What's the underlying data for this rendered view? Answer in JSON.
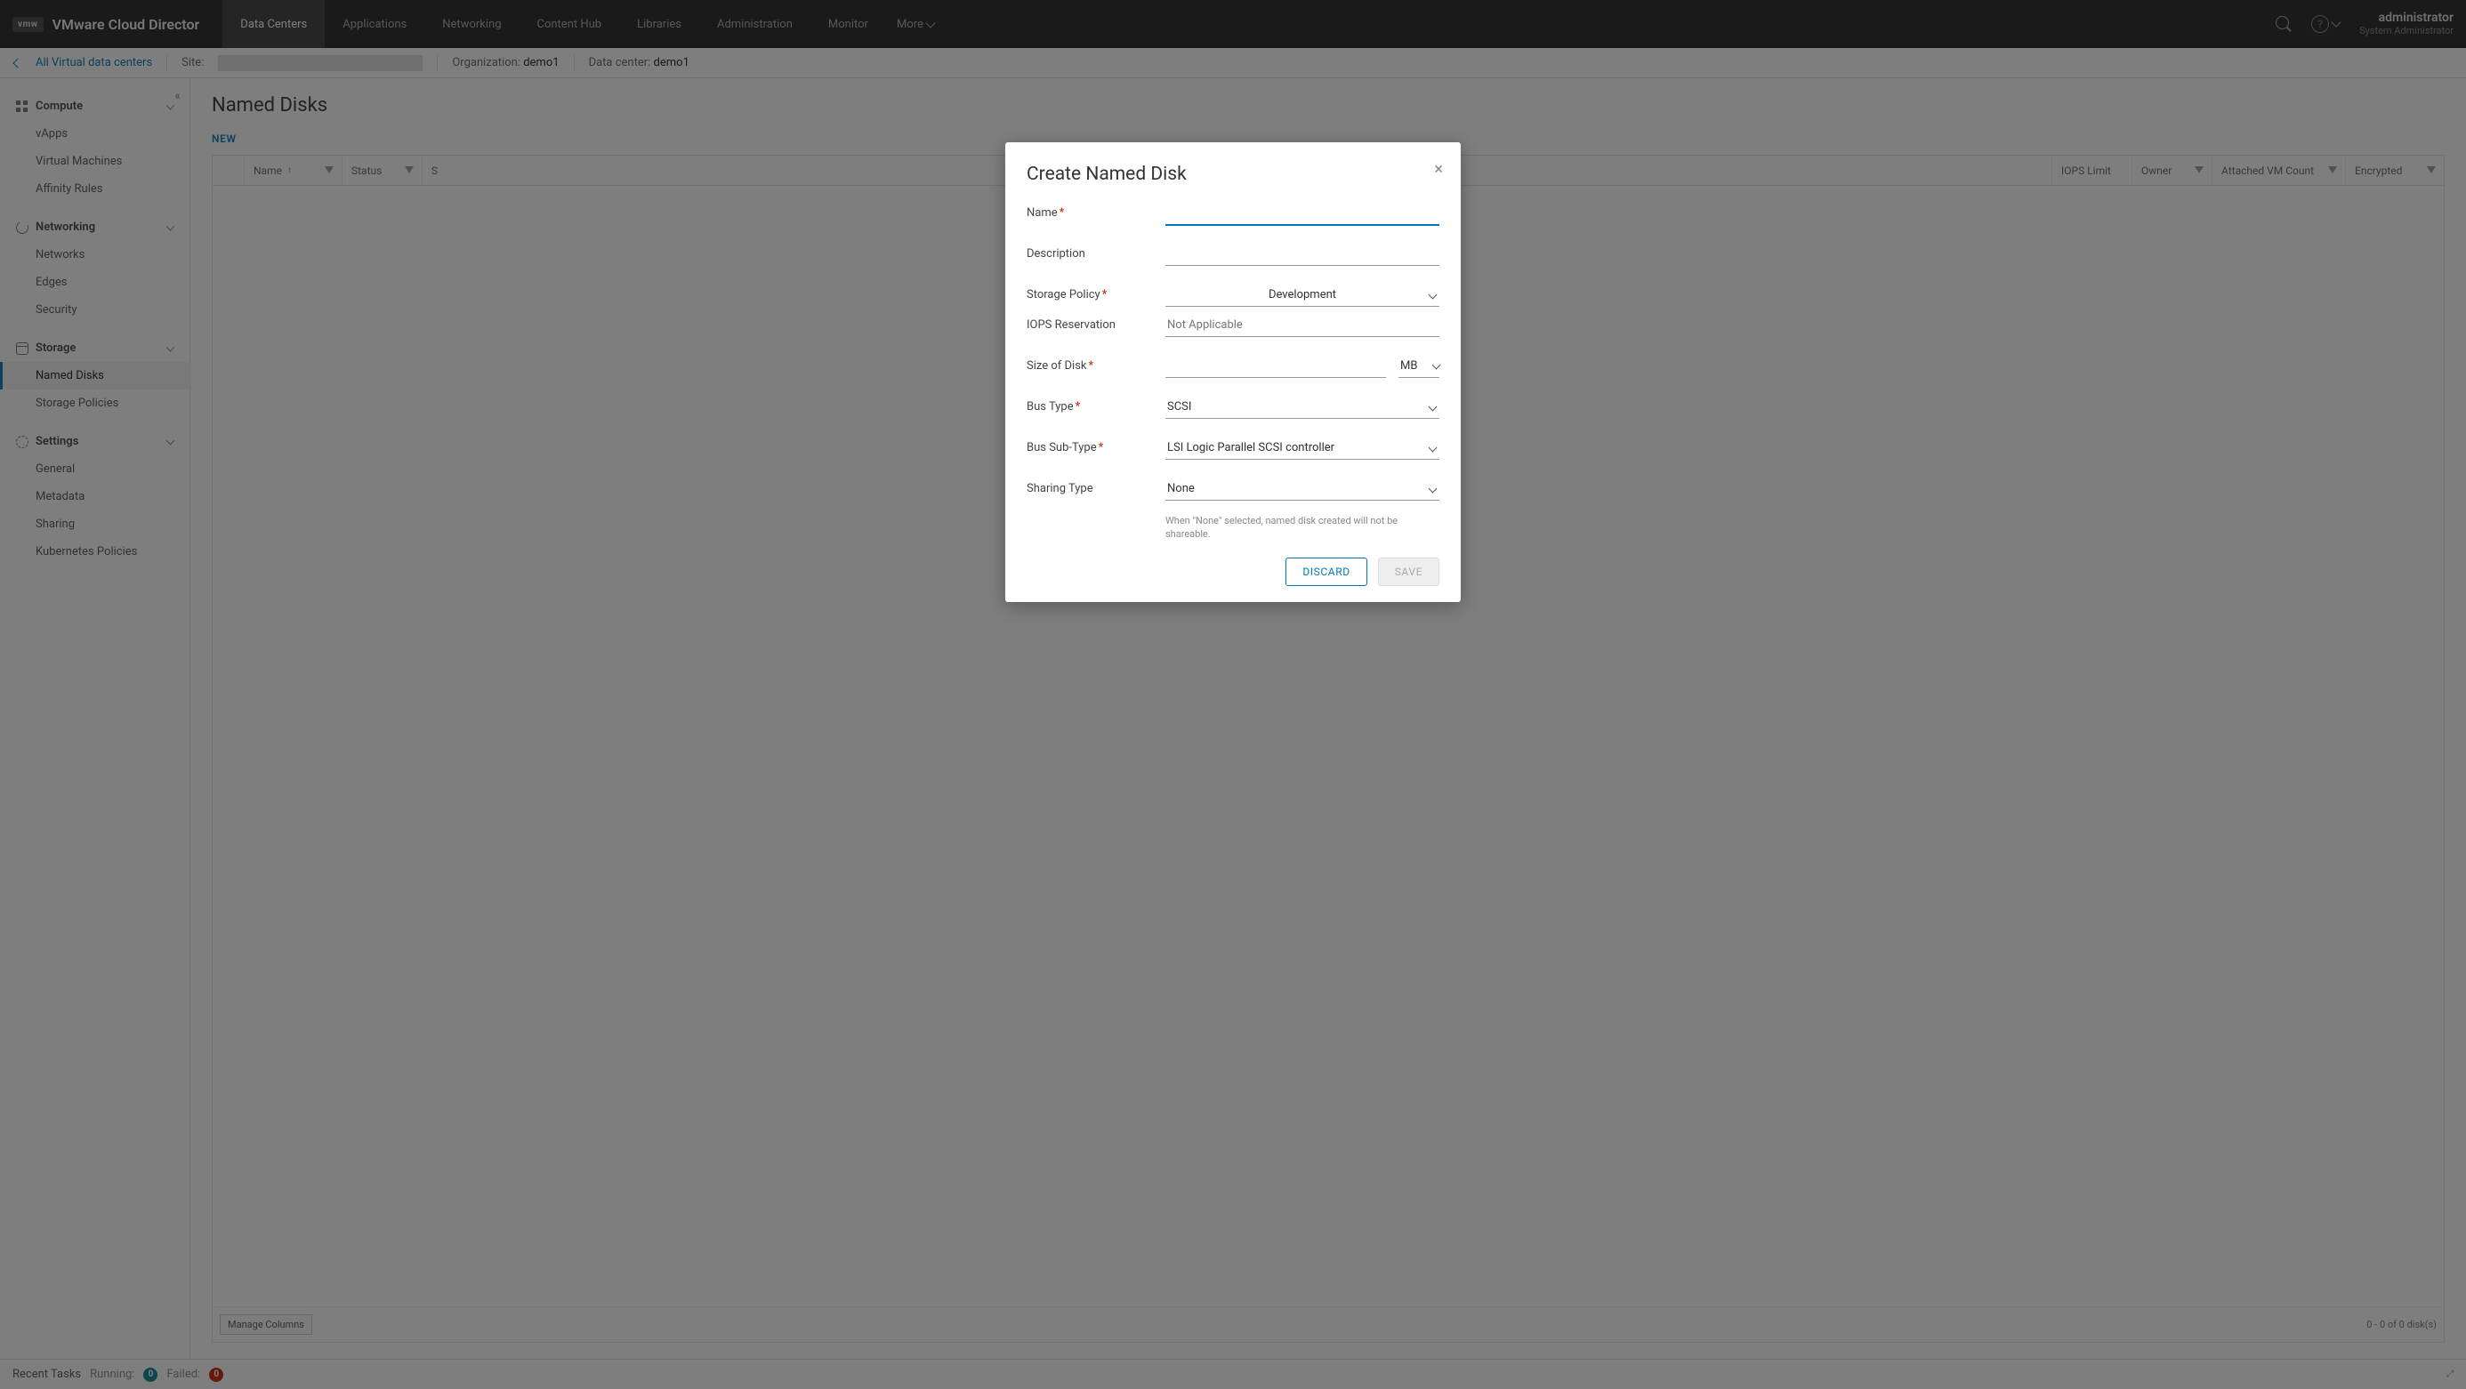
{
  "header": {
    "logo_badge": "vmw",
    "brand": "VMware Cloud Director",
    "nav": [
      "Data Centers",
      "Applications",
      "Networking",
      "Content Hub",
      "Libraries",
      "Administration",
      "Monitor"
    ],
    "more": "More",
    "user_name": "administrator",
    "user_role": "System Administrator"
  },
  "breadcrumb": {
    "back": "All Virtual data centers",
    "site_label": "Site:",
    "org_label": "Organization:",
    "org_value": "demo1",
    "dc_label": "Data center:",
    "dc_value": "demo1"
  },
  "sidebar": {
    "sections": [
      {
        "title": "Compute",
        "items": [
          "vApps",
          "Virtual Machines",
          "Affinity Rules"
        ]
      },
      {
        "title": "Networking",
        "items": [
          "Networks",
          "Edges",
          "Security"
        ]
      },
      {
        "title": "Storage",
        "items": [
          "Named Disks",
          "Storage Policies"
        ]
      },
      {
        "title": "Settings",
        "items": [
          "General",
          "Metadata",
          "Sharing",
          "Kubernetes Policies"
        ]
      }
    ],
    "active": "Named Disks"
  },
  "page": {
    "title": "Named Disks",
    "new_button": "NEW",
    "columns": [
      "Name",
      "Status",
      "S",
      "IOPS Limit",
      "Owner",
      "Attached VM Count",
      "Encrypted"
    ],
    "manage_columns": "Manage Columns",
    "pager": "0 - 0 of 0 disk(s)"
  },
  "statusbar": {
    "recent_tasks": "Recent Tasks",
    "running_label": "Running:",
    "running_count": "0",
    "failed_label": "Failed:",
    "failed_count": "0"
  },
  "modal": {
    "title": "Create Named Disk",
    "labels": {
      "name": "Name",
      "description": "Description",
      "storage_policy": "Storage Policy",
      "iops": "IOPS Reservation",
      "size": "Size of Disk",
      "bus_type": "Bus Type",
      "bus_subtype": "Bus Sub-Type",
      "sharing": "Sharing Type"
    },
    "values": {
      "name": "",
      "description": "",
      "storage_policy": "Development",
      "iops_placeholder": "Not Applicable",
      "size": "",
      "size_unit": "MB",
      "bus_type": "SCSI",
      "bus_subtype": "LSI Logic Parallel SCSI controller",
      "sharing": "None"
    },
    "helper": "When \"None\" selected, named disk created will not be shareable.",
    "discard": "DISCARD",
    "save": "SAVE"
  }
}
